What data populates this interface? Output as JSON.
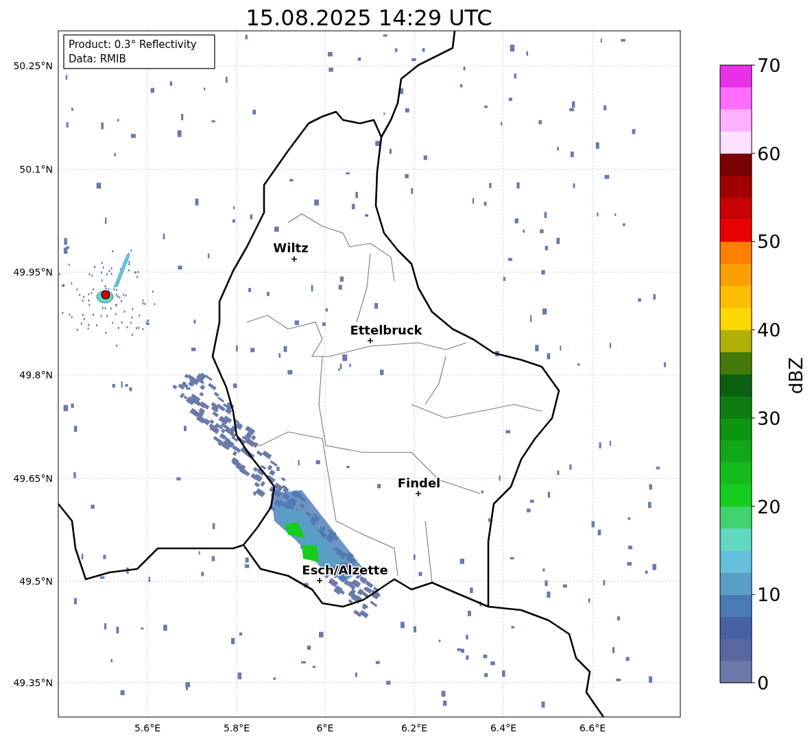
{
  "title": "15.08.2025 14:29 UTC",
  "info_box": {
    "lines": [
      "Product: 0.3° Reflectivity",
      "Data: RMIB"
    ]
  },
  "map": {
    "x_ticks": [
      "5.6°E",
      "5.8°E",
      "6°E",
      "6.2°E",
      "6.4°E",
      "6.6°E"
    ],
    "y_ticks": [
      "50.25°N",
      "50.1°N",
      "49.95°N",
      "49.8°N",
      "49.65°N",
      "49.5°N",
      "49.35°N"
    ],
    "cities": [
      {
        "name": "Wiltz"
      },
      {
        "name": "Ettelbruck"
      },
      {
        "name": "Findel"
      },
      {
        "name": "Esch/Alzette"
      }
    ]
  },
  "colorbar": {
    "label": "dBZ",
    "ticks": [
      "70",
      "60",
      "50",
      "40",
      "30",
      "20",
      "10",
      "0"
    ],
    "segments": [
      {
        "color": "#6a7aab"
      },
      {
        "color": "#56689f"
      },
      {
        "color": "#4560a5"
      },
      {
        "color": "#4a7ab4"
      },
      {
        "color": "#5a9ec8"
      },
      {
        "color": "#66c0dc"
      },
      {
        "color": "#62d8c0"
      },
      {
        "color": "#40d470"
      },
      {
        "color": "#16cc1e"
      },
      {
        "color": "#12bc1a"
      },
      {
        "color": "#10a818"
      },
      {
        "color": "#0c9412"
      },
      {
        "color": "#0c7c10"
      },
      {
        "color": "#0a6010"
      },
      {
        "color": "#447a0a"
      },
      {
        "color": "#b0b008"
      },
      {
        "color": "#fcd800"
      },
      {
        "color": "#fcbc00"
      },
      {
        "color": "#fca000"
      },
      {
        "color": "#fc7f00"
      },
      {
        "color": "#e80000"
      },
      {
        "color": "#c80000"
      },
      {
        "color": "#a00000"
      },
      {
        "color": "#780000"
      },
      {
        "color": "#ffe0ff"
      },
      {
        "color": "#ffb0ff"
      },
      {
        "color": "#ff6eff"
      },
      {
        "color": "#e830e8"
      }
    ]
  }
}
